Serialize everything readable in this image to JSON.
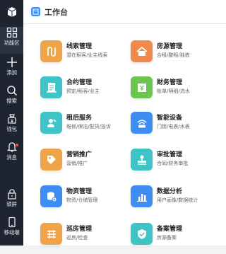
{
  "header": {
    "title": "工作台",
    "icon": "workbench-icon"
  },
  "sidebar": {
    "logo_icon": "cube-logo-icon",
    "items": [
      {
        "label": "功能区",
        "icon": "grid-icon",
        "active": true
      },
      {
        "label": "添加",
        "icon": "plus-icon"
      },
      {
        "label": "搜索",
        "icon": "search-icon"
      },
      {
        "label": "钱包",
        "icon": "wallet-icon"
      },
      {
        "label": "消息",
        "icon": "bell-icon",
        "badge": true
      },
      {
        "label": "锁屏",
        "icon": "lock-icon"
      },
      {
        "label": "移动端",
        "icon": "mobile-icon"
      }
    ]
  },
  "modules": [
    {
      "title": "线索管理",
      "desc": "潜在租客/业主线索",
      "color": "#f0a44a",
      "icon": "lead-icon"
    },
    {
      "title": "房源管理",
      "desc": "合租/整租/独栋",
      "color": "#f08a4b",
      "icon": "house-icon"
    },
    {
      "title": "合约管理",
      "desc": "预定/租客/业主",
      "color": "#3ec3c7",
      "icon": "contract-icon"
    },
    {
      "title": "财务管理",
      "desc": "账单/明细/流水",
      "color": "#6cc551",
      "icon": "finance-icon"
    },
    {
      "title": "租后服务",
      "desc": "维修/保洁/配货/投诉",
      "color": "#3ec3c7",
      "icon": "service-icon"
    },
    {
      "title": "智能设备",
      "desc": "门锁/电表/水表",
      "color": "#3d8df5",
      "icon": "device-icon"
    },
    {
      "title": "营销推广",
      "desc": "营销/推广",
      "color": "#f0a44a",
      "icon": "marketing-icon"
    },
    {
      "title": "审批管理",
      "desc": "合同/财务审批",
      "color": "#3ec3c7",
      "icon": "approval-icon"
    },
    {
      "title": "物资管理",
      "desc": "物资/仓储管理",
      "color": "#3d8df5",
      "icon": "supplies-icon"
    },
    {
      "title": "数据分析",
      "desc": "用户画像/数据统计",
      "color": "#3d8df5",
      "icon": "analytics-icon"
    },
    {
      "title": "巡房管理",
      "desc": "巡房/检查",
      "color": "#f0a44a",
      "icon": "inspection-icon"
    },
    {
      "title": "备案管理",
      "desc": "房源备案",
      "color": "#3ec3c7",
      "icon": "filing-icon"
    }
  ]
}
